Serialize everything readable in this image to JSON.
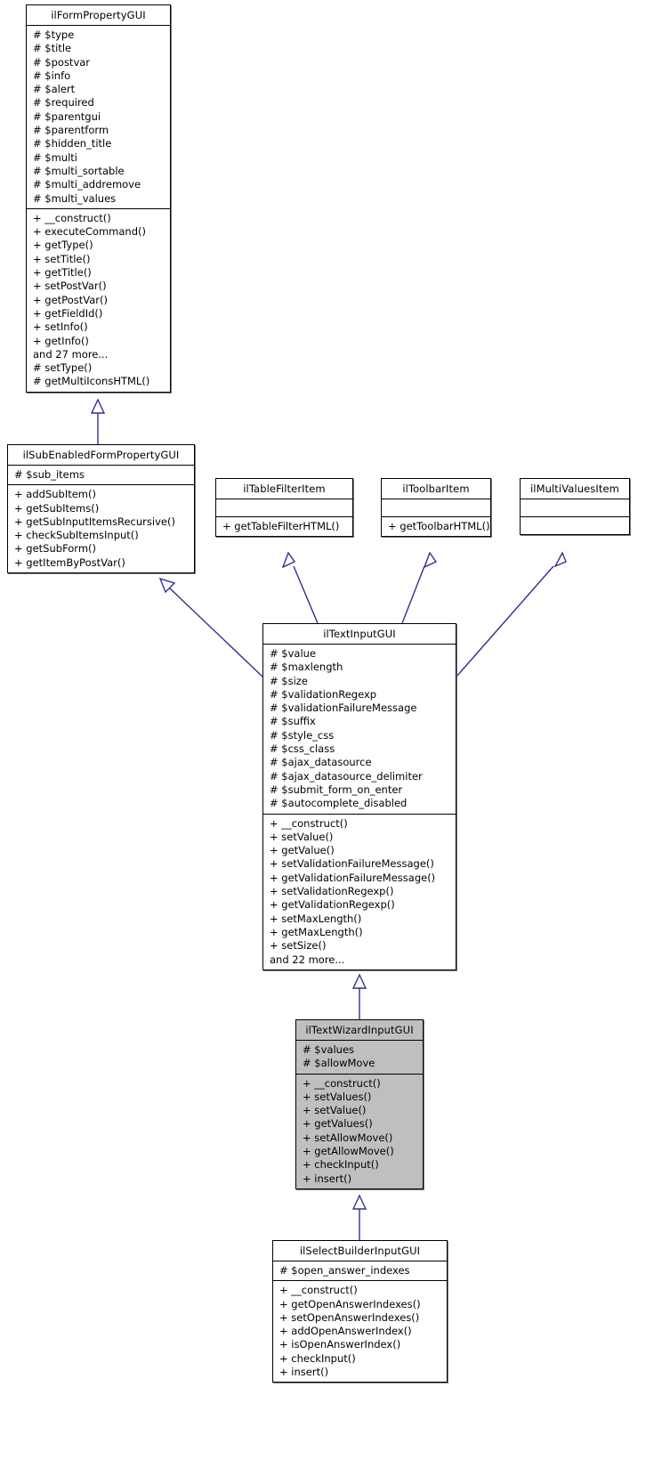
{
  "diagram": {
    "type": "uml-class-inheritance",
    "title": "ilSelectBuilderInputGUI inheritance diagram",
    "line_color": "#30308f",
    "highlight_color": "#bfbfbf",
    "box_border_color": "#000000",
    "classes": [
      {
        "id": "ilFormPropertyGUI",
        "name": "ilFormPropertyGUI",
        "highlighted": false,
        "attributes": [
          "# $type",
          "# $title",
          "# $postvar",
          "# $info",
          "# $alert",
          "# $required",
          "# $parentgui",
          "# $parentform",
          "# $hidden_title",
          "# $multi",
          "# $multi_sortable",
          "# $multi_addremove",
          "# $multi_values"
        ],
        "methods": [
          "+ __construct()",
          "+ executeCommand()",
          "+ getType()",
          "+ setTitle()",
          "+ getTitle()",
          "+ setPostVar()",
          "+ getPostVar()",
          "+ getFieldId()",
          "+ setInfo()",
          "+ getInfo()",
          "and 27 more...",
          "# setType()",
          "# getMultiIconsHTML()"
        ]
      },
      {
        "id": "ilSubEnabledFormPropertyGUI",
        "name": "ilSubEnabledFormPropertyGUI",
        "highlighted": false,
        "attributes": [
          "# $sub_items"
        ],
        "methods": [
          "+ addSubItem()",
          "+ getSubItems()",
          "+ getSubInputItemsRecursive()",
          "+ checkSubItemsInput()",
          "+ getSubForm()",
          "+ getItemByPostVar()"
        ]
      },
      {
        "id": "ilTableFilterItem",
        "name": "ilTableFilterItem",
        "highlighted": false,
        "attributes": [],
        "methods": [
          "+ getTableFilterHTML()"
        ]
      },
      {
        "id": "ilToolbarItem",
        "name": "ilToolbarItem",
        "highlighted": false,
        "attributes": [],
        "methods": [
          "+ getToolbarHTML()"
        ]
      },
      {
        "id": "ilMultiValuesItem",
        "name": "ilMultiValuesItem",
        "highlighted": false,
        "attributes": [],
        "methods": []
      },
      {
        "id": "ilTextInputGUI",
        "name": "ilTextInputGUI",
        "highlighted": false,
        "attributes": [
          "# $value",
          "# $maxlength",
          "# $size",
          "# $validationRegexp",
          "# $validationFailureMessage",
          "# $suffix",
          "# $style_css",
          "# $css_class",
          "# $ajax_datasource",
          "# $ajax_datasource_delimiter",
          "# $submit_form_on_enter",
          "# $autocomplete_disabled"
        ],
        "methods": [
          "+ __construct()",
          "+ setValue()",
          "+ getValue()",
          "+ setValidationFailureMessage()",
          "+ getValidationFailureMessage()",
          "+ setValidationRegexp()",
          "+ getValidationRegexp()",
          "+ setMaxLength()",
          "+ getMaxLength()",
          "+ setSize()",
          "and 22 more..."
        ]
      },
      {
        "id": "ilTextWizardInputGUI",
        "name": "ilTextWizardInputGUI",
        "highlighted": true,
        "attributes": [
          "# $values",
          "# $allowMove"
        ],
        "methods": [
          "+ __construct()",
          "+ setValues()",
          "+ setValue()",
          "+ getValues()",
          "+ setAllowMove()",
          "+ getAllowMove()",
          "+ checkInput()",
          "+ insert()"
        ]
      },
      {
        "id": "ilSelectBuilderInputGUI",
        "name": "ilSelectBuilderInputGUI",
        "highlighted": false,
        "attributes": [
          "# $open_answer_indexes"
        ],
        "methods": [
          "+ __construct()",
          "+ getOpenAnswerIndexes()",
          "+ setOpenAnswerIndexes()",
          "+ addOpenAnswerIndex()",
          "+ isOpenAnswerIndex()",
          "+ checkInput()",
          "+ insert()"
        ]
      }
    ],
    "inheritance_edges": [
      {
        "from": "ilSubEnabledFormPropertyGUI",
        "to": "ilFormPropertyGUI"
      },
      {
        "from": "ilTextInputGUI",
        "to": "ilSubEnabledFormPropertyGUI"
      },
      {
        "from": "ilTextInputGUI",
        "to": "ilTableFilterItem"
      },
      {
        "from": "ilTextInputGUI",
        "to": "ilToolbarItem"
      },
      {
        "from": "ilTextInputGUI",
        "to": "ilMultiValuesItem"
      },
      {
        "from": "ilTextWizardInputGUI",
        "to": "ilTextInputGUI"
      },
      {
        "from": "ilSelectBuilderInputGUI",
        "to": "ilTextWizardInputGUI"
      }
    ]
  }
}
